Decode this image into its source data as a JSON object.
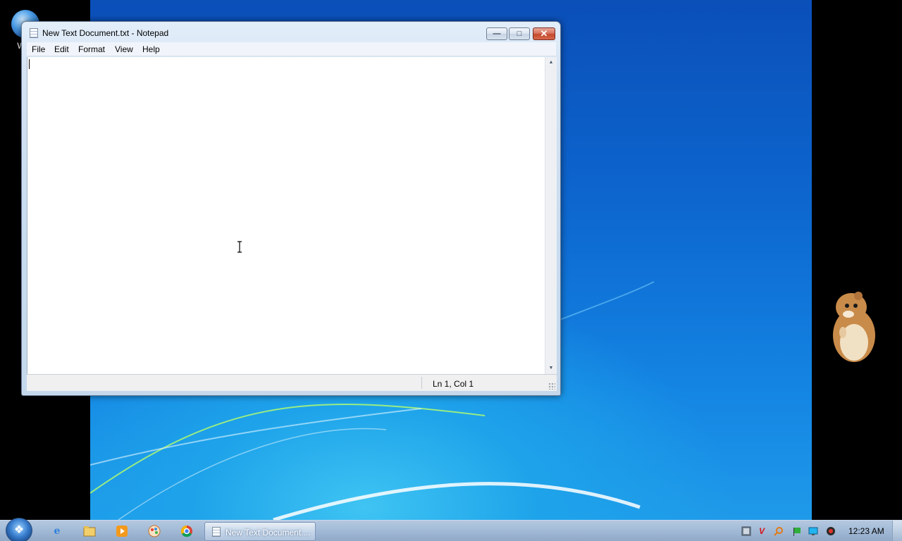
{
  "desktop": {
    "icon_label_1": "WIN",
    "icon_label_2": "V"
  },
  "window": {
    "title": "New Text Document.txt - Notepad",
    "controls": {
      "minimize_icon": "minimize-icon",
      "maximize_icon": "restore-icon",
      "close_icon": "close-icon"
    },
    "menu": [
      "File",
      "Edit",
      "Format",
      "View",
      "Help"
    ],
    "content": "",
    "status": {
      "position": "Ln 1, Col 1"
    }
  },
  "taskbar": {
    "pinned": [
      "internet-explorer-icon",
      "windows-explorer-icon",
      "media-player-icon",
      "paint-icon",
      "chrome-icon"
    ],
    "active_task_label": "New Text Document....",
    "tray": [
      "network-manager-icon",
      "antivirus-icon",
      "search-tray-icon",
      "flag-icon",
      "monitor-icon",
      "volume-icon"
    ],
    "clock": "12:23 AM"
  },
  "colors": {
    "wallpaper": "#0d67cf",
    "close_button": "#c44a2e",
    "window_frame": "#c8dbef"
  }
}
